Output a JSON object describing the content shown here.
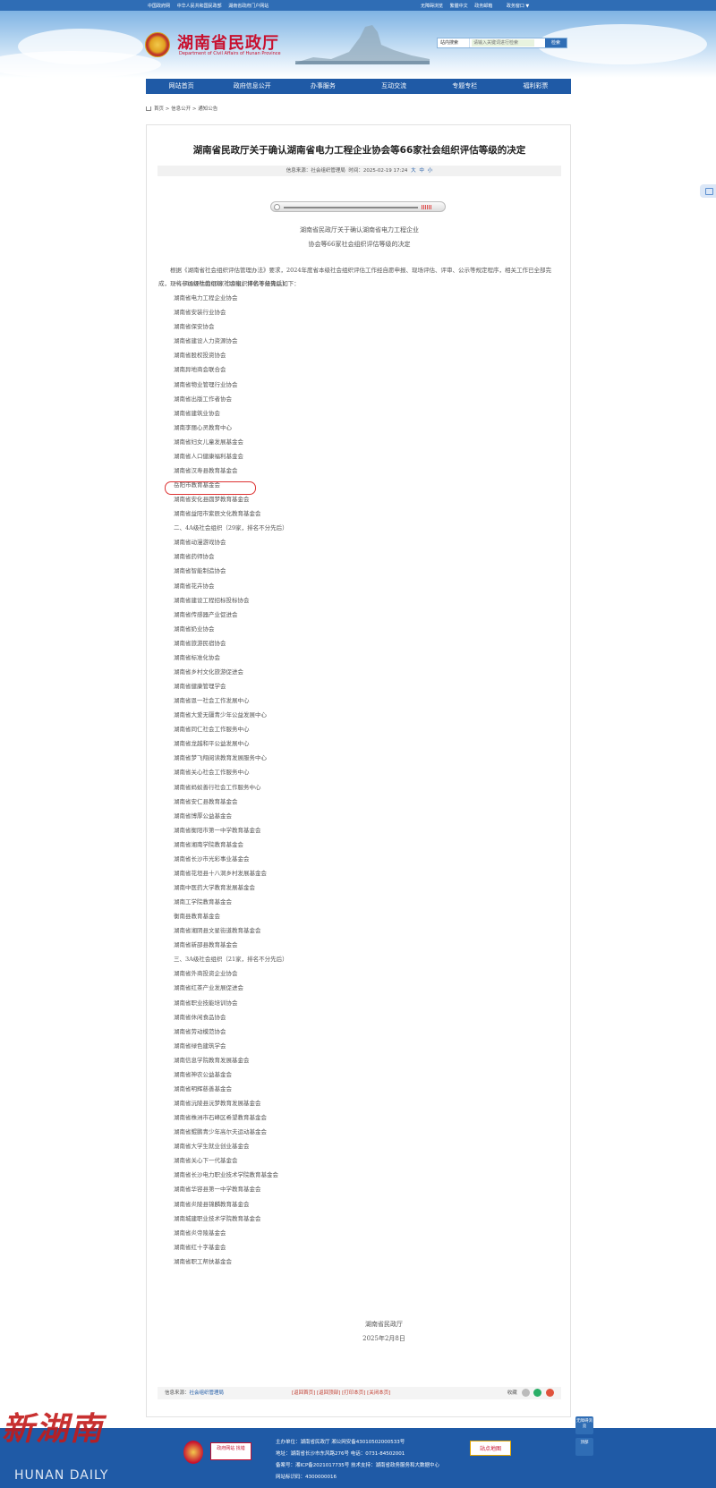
{
  "topbar": {
    "left_links": [
      "中国政府网",
      "中华人民共和国民政部",
      "湖南省政府门户网站"
    ],
    "right_links": [
      "无障碍浏览",
      "繁體中文",
      "政务邮箱"
    ],
    "portal": "政务窗口 ▼"
  },
  "header": {
    "title": "湖南省民政厅",
    "subtitle": "Department of Civil Affairs of Hunan Province",
    "search_scope": "站内搜索",
    "search_placeholder": "请输入关键词进行检索",
    "search_button": "检索"
  },
  "nav": [
    "网站首页",
    "政府信息公开",
    "办事服务",
    "互动交流",
    "专题专栏",
    "福利彩票"
  ],
  "breadcrumb": "首页 > 信息公开 > 通知公告",
  "article": {
    "title": "湖南省民政厅关于确认湖南省电力工程企业协会等66家社会组织评估等级的决定",
    "meta_source_label": "信息来源：",
    "meta_source": "社会组织管理局",
    "meta_time_label": "时间：",
    "meta_time": "2025-02-19 17:24",
    "font_sizes": [
      "大",
      "中",
      "小"
    ],
    "intro_lines": [
      "湖南省民政厅关于确认湖南省电力工程企业",
      "协会等66家社会组织评估等级的决定"
    ],
    "paragraph": "根据《湖南省社会组织评估管理办法》要求，2024年度省本级社会组织评估工作经自愿申报、现场评估、评审、公示等规定程序，相关工作已全部完成，现将参加评估的66家社会组织评估等级确认如下：",
    "sections": [
      {
        "heading": "一、5A级社会组织（16家，排名不分先后）",
        "items": [
          "湖南省电力工程企业协会",
          "湖南省安装行业协会",
          "湖南省保安协会",
          "湖南省建设人力资源协会",
          "湖南省股权投资协会",
          "湖南异地商会联合会",
          "湖南省物业管理行业协会",
          "湖南省出版工作者协会",
          "湖南省建筑业协会",
          "湖南李丽心灵教育中心",
          "湖南省妇女儿童发展基金会",
          "湖南省人口健康福利基金会",
          "湖南省汉寿县教育基金会",
          "岳阳市教育基金会",
          "湖南省安化县圆梦教育基金会",
          "湖南省益阳市紫辰文化教育基金会"
        ]
      },
      {
        "heading": "二、4A级社会组织（29家，排名不分先后）",
        "items": [
          "湖南省动漫游戏协会",
          "湖南省药师协会",
          "湖南省智能制造协会",
          "湖南省花卉协会",
          "湖南省建设工程招标投标协会",
          "湖南省传感器产业促进会",
          "湖南省奶业协会",
          "湖南省旅游民宿协会",
          "湖南省标准化协会",
          "湖南省乡村文化旅游促进会",
          "湖南省健康管理学会",
          "湖南省恩一社会工作发展中心",
          "湖南省大爱无疆青少年公益发展中心",
          "湖南省同仁社会工作服务中心",
          "湖南省龙越和平公益发展中心",
          "湖南省梦飞翔阅读教育发展服务中心",
          "湖南省关心社会工作服务中心",
          "湖南省蚂蚁善行社会工作服务中心",
          "湖南省安仁县教育基金会",
          "湖南省博厚公益基金会",
          "湖南省衡阳市第一中学教育基金会",
          "湖南省湘南学院教育基金会",
          "湖南省长沙市光彩事业基金会",
          "湖南省花垣县十八洞乡村发展基金会",
          "湖南中医药大学教育发展基金会",
          "湖南工学院教育基金会",
          "衡南县教育基金会",
          "湖南省湘阴县文星街道教育基金会",
          "湖南省新邵县教育基金会"
        ]
      },
      {
        "heading": "三、3A级社会组织（21家，排名不分先后）",
        "items": [
          "湖南省外商投资企业协会",
          "湖南省红茶产业发展促进会",
          "湖南省职业技能培训协会",
          "湖南省休闲食品协会",
          "湖南省劳动模范协会",
          "湖南省绿色建筑学会",
          "湖南信息学院教育发展基金会",
          "湖南省神农公益基金会",
          "湖南省明辉慈善基金会",
          "湖南省沅陵县沅梦教育发展基金会",
          "湖南省株洲市石峰区希望教育基金会",
          "湖南省鲲鹏青少年高尔夫运动基金会",
          "湖南省大学生就业创业基金会",
          "湖南省关心下一代基金会",
          "湖南省长沙电力职业技术学院教育基金会",
          "湖南省华容县第一中学教育基金会",
          "湖南省炎陵县锦麟教育基金会",
          "湖南城建职业技术学院教育基金会",
          "湖南省炎帝陵基金会",
          "湖南省红十字基金会",
          "湖南省职工帮扶基金会"
        ]
      }
    ],
    "signature": "湖南省民政厅",
    "date": "2025年2月8日",
    "foot_source_label": "信息来源：",
    "foot_source": "社会组织管理局",
    "foot_actions": "[返回首页] [返回顶部] [打印本页] [关闭本页]",
    "share_label": "收藏"
  },
  "footer": {
    "watermark": "新湖南",
    "watermark_en": "HUNAN DAILY",
    "gov_logo_text": "政府网站 找错",
    "info_lines": [
      "主办单位：湖南省民政厅   湘公网安备43010502000533号",
      "地址：湖南省长沙市东风路276号 电话：0731-84502001",
      "备案号：湘ICP备2021017735号   技术支持：湖南省政务服务和大数据中心",
      "网站标识码：4300000016"
    ],
    "map_badge": "站点地图",
    "float_a": "无障碍浏览",
    "float_b": "顶部"
  },
  "colors": {
    "nav_blue": "#1f5aa6",
    "brand_red": "#c8102e"
  }
}
